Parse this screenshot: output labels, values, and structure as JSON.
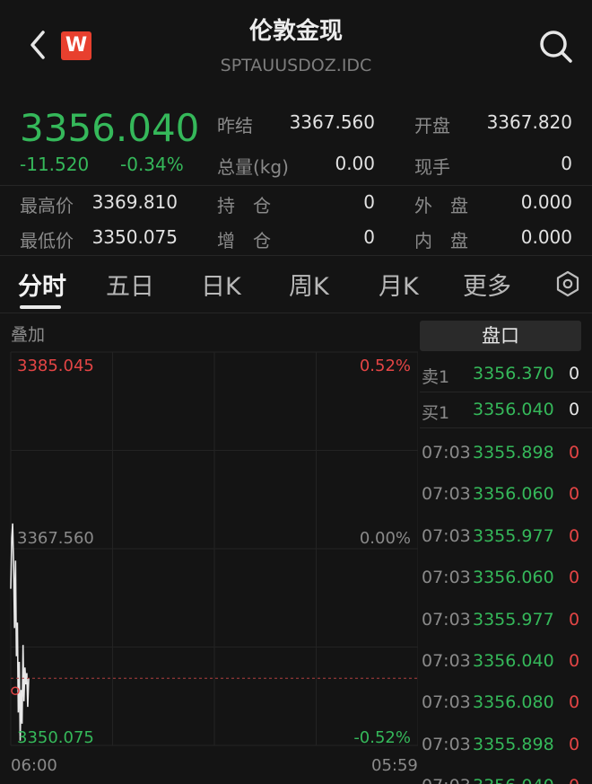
{
  "header": {
    "back_icon": "chevron-left-icon",
    "logo_text": "W",
    "title": "伦敦金现",
    "code": "SPTAUUSDOZ.IDC",
    "search_icon": "search-icon"
  },
  "quote": {
    "price": "3356.040",
    "change": "-11.520",
    "change_pct": "-0.34%",
    "fields": [
      {
        "label": "昨结",
        "value": "3367.560"
      },
      {
        "label": "开盘",
        "value": "3367.820"
      },
      {
        "label": "总量(kg)",
        "value": "0.00"
      },
      {
        "label": "现手",
        "value": "0"
      },
      {
        "label": "最高价",
        "value": "3369.810"
      },
      {
        "label": "持　仓",
        "value": "0"
      },
      {
        "label": "外　盘",
        "value": "0.000"
      },
      {
        "label": "最低价",
        "value": "3350.075"
      },
      {
        "label": "增　仓",
        "value": "0"
      },
      {
        "label": "内　盘",
        "value": "0.000"
      }
    ]
  },
  "tabs": [
    "分时",
    "五日",
    "日K",
    "周K",
    "月K",
    "更多"
  ],
  "settings_icon": "hexagon-settings-icon",
  "chart": {
    "overlay_label": "叠加",
    "top_price": "3385.045",
    "top_pct": "0.52%",
    "mid_price": "3367.560",
    "mid_pct": "0.00%",
    "bottom_price": "3350.075",
    "bottom_pct": "-0.52%",
    "time_start": "06:00",
    "time_end": "05:59"
  },
  "chart_data": {
    "type": "line",
    "ylim": [
      3350.075,
      3385.045
    ],
    "reference": 3367.56,
    "current": 3356.04,
    "series": [
      {
        "values": [
          3364.0,
          3368.5,
          3369.8,
          3366.0,
          3360.5,
          3366.5,
          3358.0,
          3361.0,
          3353.0,
          3357.5,
          3350.5,
          3355.0,
          3352.0,
          3359.0,
          3354.0,
          3357.0,
          3355.5,
          3356.5,
          3353.5,
          3356.04
        ]
      }
    ]
  },
  "book": {
    "title": "盘口",
    "sell": {
      "label": "卖1",
      "price": "3356.370",
      "vol": "0"
    },
    "buy": {
      "label": "买1",
      "price": "3356.040",
      "vol": "0"
    },
    "ticks": [
      {
        "time": "07:03",
        "price": "3355.898",
        "vol": "0"
      },
      {
        "time": "07:03",
        "price": "3356.060",
        "vol": "0"
      },
      {
        "time": "07:03",
        "price": "3355.977",
        "vol": "0"
      },
      {
        "time": "07:03",
        "price": "3356.060",
        "vol": "0"
      },
      {
        "time": "07:03",
        "price": "3355.977",
        "vol": "0"
      },
      {
        "time": "07:03",
        "price": "3356.040",
        "vol": "0"
      },
      {
        "time": "07:03",
        "price": "3356.080",
        "vol": "0"
      },
      {
        "time": "07:03",
        "price": "3355.898",
        "vol": "0"
      },
      {
        "time": "07:03",
        "price": "3356.040",
        "vol": "0"
      }
    ]
  },
  "colors": {
    "up": "#e44545",
    "down": "#35b85a",
    "background": "#141414"
  }
}
